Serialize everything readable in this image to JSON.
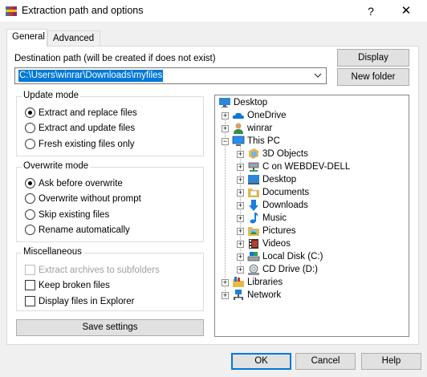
{
  "window": {
    "title": "Extraction path and options",
    "help_glyph": "?",
    "close_glyph": "✕"
  },
  "tabs": [
    {
      "label": "General",
      "active": true
    },
    {
      "label": "Advanced",
      "active": false
    }
  ],
  "destination": {
    "label": "Destination path (will be created if does not exist)",
    "value": "C:\\Users\\winrar\\Downloads\\myfiles"
  },
  "buttons": {
    "display": "Display",
    "new_folder": "New folder",
    "save_settings": "Save settings",
    "ok": "OK",
    "cancel": "Cancel",
    "help": "Help"
  },
  "update_mode": {
    "title": "Update mode",
    "options": [
      {
        "label": "Extract and replace files",
        "selected": true
      },
      {
        "label": "Extract and update files",
        "selected": false
      },
      {
        "label": "Fresh existing files only",
        "selected": false
      }
    ]
  },
  "overwrite_mode": {
    "title": "Overwrite mode",
    "options": [
      {
        "label": "Ask before overwrite",
        "selected": true
      },
      {
        "label": "Overwrite without prompt",
        "selected": false
      },
      {
        "label": "Skip existing files",
        "selected": false
      },
      {
        "label": "Rename automatically",
        "selected": false
      }
    ]
  },
  "miscellaneous": {
    "title": "Miscellaneous",
    "options": [
      {
        "label": "Extract archives to subfolders",
        "checked": false,
        "enabled": false
      },
      {
        "label": "Keep broken files",
        "checked": false,
        "enabled": true
      },
      {
        "label": "Display files in Explorer",
        "checked": false,
        "enabled": true
      }
    ]
  },
  "tree": {
    "root": {
      "label": "Desktop",
      "icon": "desktop-icon"
    },
    "items": [
      {
        "label": "OneDrive",
        "icon": "cloud-icon",
        "expander": "+"
      },
      {
        "label": "winrar",
        "icon": "user-icon",
        "expander": "+"
      },
      {
        "label": "This PC",
        "icon": "computer-icon",
        "expander": "−",
        "children": [
          {
            "label": "3D Objects",
            "icon": "cube-icon",
            "expander": "+"
          },
          {
            "label": "C on WEBDEV-DELL",
            "icon": "network-drive-icon",
            "expander": "+"
          },
          {
            "label": "Desktop",
            "icon": "desktop-icon",
            "expander": "+"
          },
          {
            "label": "Documents",
            "icon": "documents-icon",
            "expander": "+"
          },
          {
            "label": "Downloads",
            "icon": "download-icon",
            "expander": "+"
          },
          {
            "label": "Music",
            "icon": "music-icon",
            "expander": "+"
          },
          {
            "label": "Pictures",
            "icon": "pictures-icon",
            "expander": "+"
          },
          {
            "label": "Videos",
            "icon": "video-icon",
            "expander": "+"
          },
          {
            "label": "Local Disk (C:)",
            "icon": "local-disk-icon",
            "expander": "+"
          },
          {
            "label": "CD Drive (D:)",
            "icon": "cd-drive-icon",
            "expander": "+"
          }
        ]
      },
      {
        "label": "Libraries",
        "icon": "library-icon",
        "expander": "+"
      },
      {
        "label": "Network",
        "icon": "network-icon",
        "expander": "+"
      }
    ]
  },
  "colors": {
    "accent": "#0078d7",
    "folder": "#e8b84a"
  }
}
